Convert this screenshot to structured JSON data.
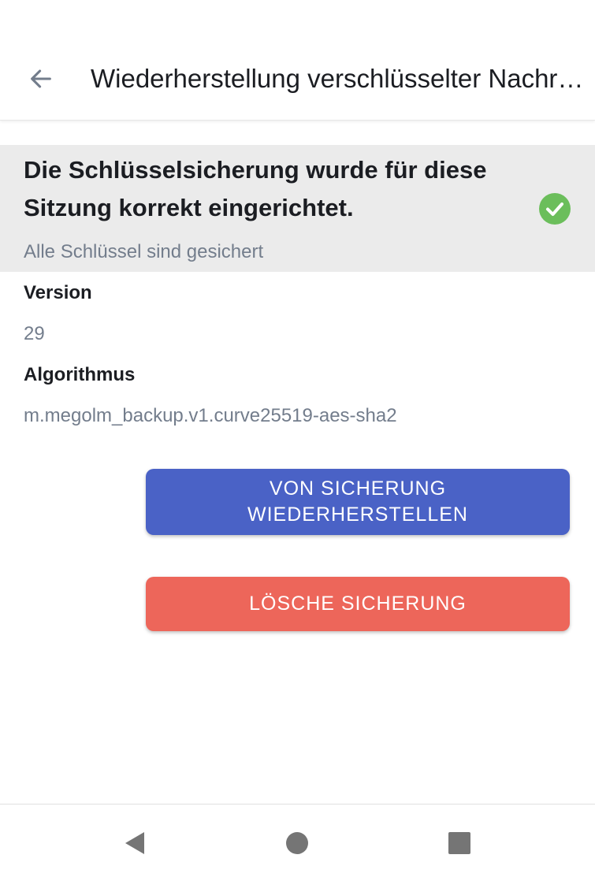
{
  "toolbar": {
    "back_icon": "arrow-left-icon",
    "title": "Wiederherstellung verschlüsselter Nachrichten"
  },
  "status": {
    "title": "Die Schlüsselsicherung wurde für diese Sitzung korrekt eingerichtet.",
    "subtitle": "Alle Schlüssel sind gesichert",
    "icon": "check-circle-icon",
    "icon_color": "#6bbe5b"
  },
  "details": {
    "version_label": "Version",
    "version_value": "29",
    "algorithm_label": "Algorithmus",
    "algorithm_value": "m.megolm_backup.v1.curve25519-aes-sha2"
  },
  "actions": {
    "restore_label": "VON SICHERUNG WIEDERHERSTELLEN",
    "restore_color": "#4a62c6",
    "delete_label": "LÖSCHE SICHERUNG",
    "delete_color": "#ed665a"
  },
  "navbar": {
    "back_icon": "triangle-back-icon",
    "home_icon": "circle-home-icon",
    "recents_icon": "square-recents-icon"
  }
}
